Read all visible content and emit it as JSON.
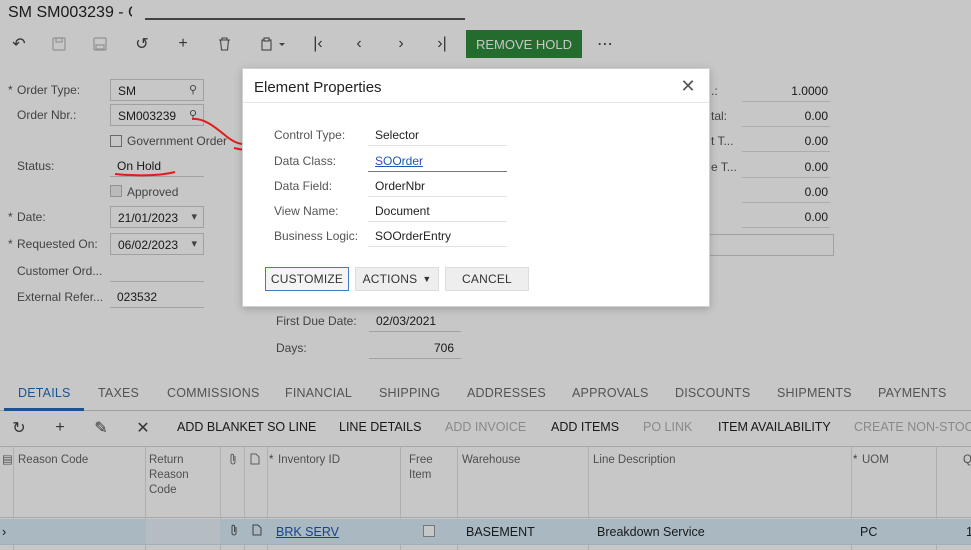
{
  "header": {
    "title": "SM SM003239 - C"
  },
  "toolbar": {
    "remove_hold": "REMOVE HOLD",
    "more": "⋯"
  },
  "form": {
    "order_type_label": "Order Type:",
    "order_type_value": "SM",
    "order_nbr_label": "Order Nbr.:",
    "order_nbr_value": "SM003239",
    "government_order_label": "Government Order",
    "status_label": "Status:",
    "status_value": "On Hold",
    "approved_label": "Approved",
    "date_label": "Date:",
    "date_value": "21/01/2023",
    "requested_on_label": "Requested On:",
    "requested_on_value": "06/02/2023",
    "customer_ord_label": "Customer Ord...",
    "external_refer_label": "External Refer...",
    "external_refer_value": "023532",
    "first_due_date_label": "First Due Date:",
    "first_due_date_value": "02/03/2021",
    "days_label": "Days:",
    "days_value": "706"
  },
  "summary": {
    "labels": [
      ".:",
      "tal:",
      "t T...",
      "e T..."
    ],
    "values": [
      "1.0000",
      "0.00",
      "0.00",
      "0.00",
      "0.00",
      "0.00"
    ]
  },
  "tabs": [
    "DETAILS",
    "TAXES",
    "COMMISSIONS",
    "FINANCIAL",
    "SHIPPING",
    "ADDRESSES",
    "APPROVALS",
    "DISCOUNTS",
    "SHIPMENTS",
    "PAYMENTS"
  ],
  "grid_toolbar": {
    "add_blanket": "ADD BLANKET SO LINE",
    "line_details": "LINE DETAILS",
    "add_invoice": "ADD INVOICE",
    "add_items": "ADD ITEMS",
    "po_link": "PO LINK",
    "item_availability": "ITEM AVAILABILITY",
    "create_non_stock": "CREATE NON-STOC"
  },
  "grid": {
    "headers": {
      "reason_code": "Reason Code",
      "return_reason_code": "Return\nReason\nCode",
      "inventory_id": "Inventory ID",
      "free_item": "Free\nItem",
      "warehouse": "Warehouse",
      "line_description": "Line Description",
      "uom": "UOM",
      "q": "Q"
    },
    "row": {
      "inventory_id": "BRK SERV",
      "warehouse": "BASEMENT",
      "line_description": "Breakdown Service",
      "uom": "PC",
      "q": "1"
    }
  },
  "dialog": {
    "title": "Element Properties",
    "fields": [
      {
        "label": "Control Type:",
        "value": "Selector"
      },
      {
        "label": "Data Class:",
        "value": "SOOrder"
      },
      {
        "label": "Data Field:",
        "value": "OrderNbr"
      },
      {
        "label": "View Name:",
        "value": "Document"
      },
      {
        "label": "Business Logic:",
        "value": "SOOrderEntry"
      }
    ],
    "customize": "CUSTOMIZE",
    "actions": "ACTIONS",
    "cancel": "CANCEL"
  },
  "colors": {
    "accent_blue": "#1f6cbf",
    "remove_hold_green": "#2e8b3a",
    "annotation_red": "#e21b1b"
  }
}
